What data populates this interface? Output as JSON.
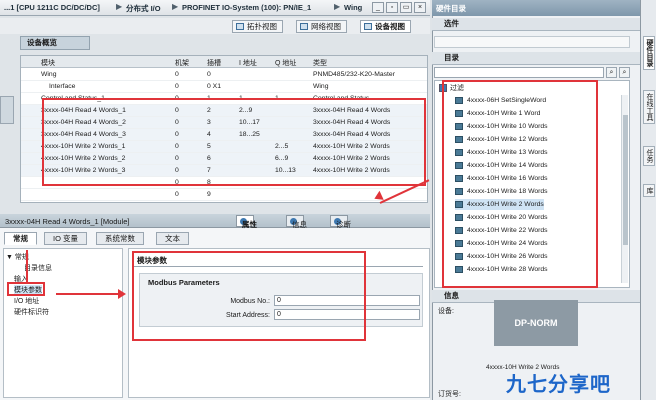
{
  "titlebar": {
    "crumbs": [
      "...1 [CPU 1211C DC/DC/DC]",
      "分布式 I/O",
      "PROFINET IO-System (100): PN/IE_1",
      "Wing"
    ],
    "separators": [
      "▶",
      "▶",
      "▶"
    ],
    "buttons": [
      "_",
      "▫",
      "▭",
      "×"
    ]
  },
  "view_tabs": {
    "topology": "拓扑视图",
    "network": "网络视图",
    "device": "设备视图"
  },
  "overview_title": "设备概览",
  "grid": {
    "columns": [
      "模块",
      "机架",
      "插槽",
      "I 地址",
      "Q 地址",
      "类型"
    ],
    "rows": [
      {
        "module": "Wing",
        "rack": "0",
        "slot": "0",
        "i_addr": "",
        "q_addr": "",
        "type": "PNMD485/232-K20-Master"
      },
      {
        "module": "Interface",
        "rack": "0",
        "slot": "0 X1",
        "i_addr": "",
        "q_addr": "",
        "type": "Wing"
      },
      {
        "module": "Control and Status_1",
        "rack": "0",
        "slot": "1",
        "i_addr": "1",
        "q_addr": "1",
        "type": "Control and Status"
      },
      {
        "module": "3xxxx-04H Read 4 Words_1",
        "rack": "0",
        "slot": "2",
        "i_addr": "2...9",
        "q_addr": "",
        "type": "3xxxx-04H Read 4 Words"
      },
      {
        "module": "3xxxx-04H Read 4 Words_2",
        "rack": "0",
        "slot": "3",
        "i_addr": "10...17",
        "q_addr": "",
        "type": "3xxxx-04H Read 4 Words"
      },
      {
        "module": "3xxxx-04H Read 4 Words_3",
        "rack": "0",
        "slot": "4",
        "i_addr": "18...25",
        "q_addr": "",
        "type": "3xxxx-04H Read 4 Words"
      },
      {
        "module": "4xxxx-10H Write 2 Words_1",
        "rack": "0",
        "slot": "5",
        "i_addr": "",
        "q_addr": "2...5",
        "type": "4xxxx-10H Write 2 Words"
      },
      {
        "module": "4xxxx-10H Write 2 Words_2",
        "rack": "0",
        "slot": "6",
        "i_addr": "",
        "q_addr": "6...9",
        "type": "4xxxx-10H Write 2 Words"
      },
      {
        "module": "4xxxx-10H Write 2 Words_3",
        "rack": "0",
        "slot": "7",
        "i_addr": "",
        "q_addr": "10...13",
        "type": "4xxxx-10H Write 2 Words"
      },
      {
        "module": "",
        "rack": "0",
        "slot": "8",
        "i_addr": "",
        "q_addr": "",
        "type": ""
      },
      {
        "module": "",
        "rack": "0",
        "slot": "9",
        "i_addr": "",
        "q_addr": "",
        "type": ""
      }
    ]
  },
  "props": {
    "title": "3xxxx-04H Read 4 Words_1 [Module]",
    "inspector_tabs": [
      "属性",
      "信息",
      "诊断"
    ],
    "tabs": [
      "常规",
      "IO 变量",
      "系统常数",
      "文本"
    ],
    "nav": [
      "▼ 常规",
      "目录信息",
      "输入",
      "模块参数",
      "I/O 地址",
      "硬件标识符"
    ],
    "section": "模块参数",
    "group": "Modbus Parameters",
    "fields": [
      {
        "label": "Modbus No.:",
        "value": "0"
      },
      {
        "label": "Start Address:",
        "value": "0"
      }
    ]
  },
  "catalog": {
    "panel_title": "硬件目录",
    "options": "选件",
    "catalog_section": "目录",
    "filter": "过滤",
    "items": [
      "4xxxx-06H SetSingleWord",
      "4xxxx-10H Write 1 Word",
      "4xxxx-10H Write 10 Words",
      "4xxxx-10H Write 12 Words",
      "4xxxx-10H Write 13 Words",
      "4xxxx-10H Write 14 Words",
      "4xxxx-10H Write 16 Words",
      "4xxxx-10H Write 18 Words",
      "4xxxx-10H Write 2 Words",
      "4xxxx-10H Write 20 Words",
      "4xxxx-10H Write 22 Words",
      "4xxxx-10H Write 24 Words",
      "4xxxx-10H Write 26 Words",
      "4xxxx-10H Write 28 Words"
    ],
    "info_section": "信息",
    "device_label": "设备:",
    "device_image_text": "DP-NORM",
    "device_name": "4xxxx-10H Write 2 Words",
    "order_label": "订货号:"
  },
  "side_tabs": [
    "硬件目录",
    "在线工具",
    "任务",
    "库"
  ],
  "watermark": "九七分享吧"
}
